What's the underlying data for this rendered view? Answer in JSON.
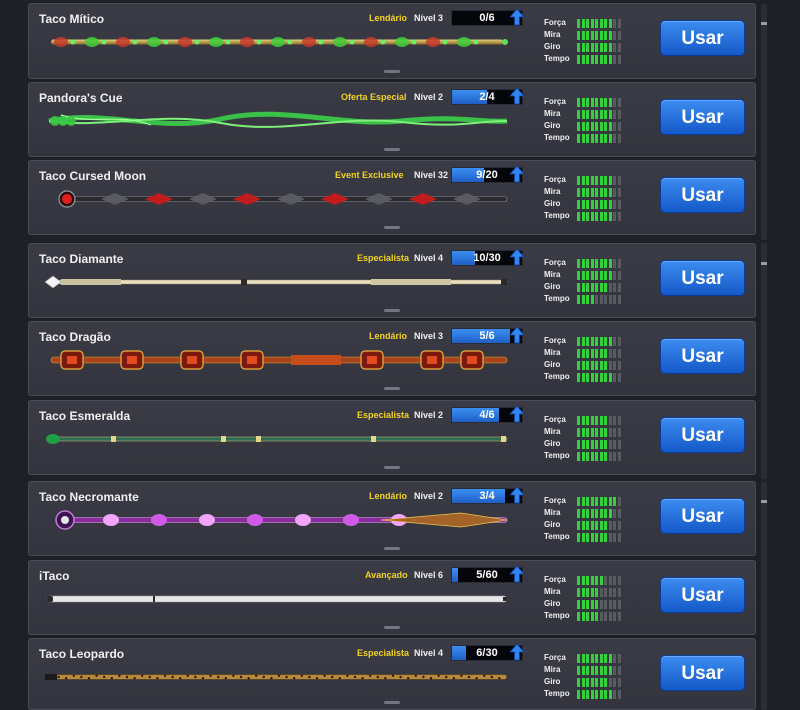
{
  "stat_labels": [
    "Força",
    "Mira",
    "Giro",
    "Tempo"
  ],
  "cues": [
    {
      "name": "Taco Mítico",
      "tier": "Lendário",
      "level": "Nível 3",
      "progress": "0/6",
      "progress_fraction": 0.0,
      "button": "Usar",
      "stats": [
        8,
        8,
        8,
        8
      ],
      "style": "mitico"
    },
    {
      "name": "Pandora's Cue",
      "tier": "Oferta Especial",
      "level": "Nível 2",
      "progress": "2/4",
      "progress_fraction": 0.5,
      "button": "Usar",
      "stats": [
        8,
        8,
        8,
        8
      ],
      "style": "pandora"
    },
    {
      "name": "Taco Cursed Moon",
      "tier": "Event Exclusive",
      "level": "Nível 32",
      "progress": "9/20",
      "progress_fraction": 0.45,
      "button": "Usar",
      "stats": [
        8,
        8,
        8,
        8
      ],
      "style": "cursed"
    },
    {
      "name": "Taco Diamante",
      "tier": "Especialista",
      "level": "Nível 4",
      "progress": "10/30",
      "progress_fraction": 0.33,
      "button": "Usar",
      "stats": [
        8,
        8,
        7,
        4
      ],
      "style": "diamante"
    },
    {
      "name": "Taco Dragão",
      "tier": "Lendário",
      "level": "Nível 3",
      "progress": "5/6",
      "progress_fraction": 0.83,
      "button": "Usar",
      "stats": [
        8,
        7,
        7,
        8
      ],
      "style": "dragao"
    },
    {
      "name": "Taco Esmeralda",
      "tier": "Especialista",
      "level": "Nível 2",
      "progress": "4/6",
      "progress_fraction": 0.67,
      "button": "Usar",
      "stats": [
        7,
        7,
        7,
        7
      ],
      "style": "esmeralda"
    },
    {
      "name": "Taco Necromante",
      "tier": "Lendário",
      "level": "Nível 2",
      "progress": "3/4",
      "progress_fraction": 0.75,
      "button": "Usar",
      "stats": [
        9,
        8,
        7,
        7
      ],
      "style": "necromante"
    },
    {
      "name": "iTaco",
      "tier": "Avançado",
      "level": "Nível 6",
      "progress": "5/60",
      "progress_fraction": 0.08,
      "button": "Usar",
      "stats": [
        6,
        5,
        5,
        5
      ],
      "style": "itaco"
    },
    {
      "name": "Taco Leopardo",
      "tier": "Especialista",
      "level": "Nível 4",
      "progress": "6/30",
      "progress_fraction": 0.2,
      "button": "Usar",
      "stats": [
        8,
        8,
        7,
        8
      ],
      "style": "leopardo"
    }
  ],
  "colors": {
    "tier": "#f2d324",
    "stat_on": "#34d23a",
    "button": "#1f6fe0",
    "progress": "#2f7be8"
  },
  "icons": {
    "level_up": "up-arrow-icon",
    "scroll": "scrollbar"
  }
}
